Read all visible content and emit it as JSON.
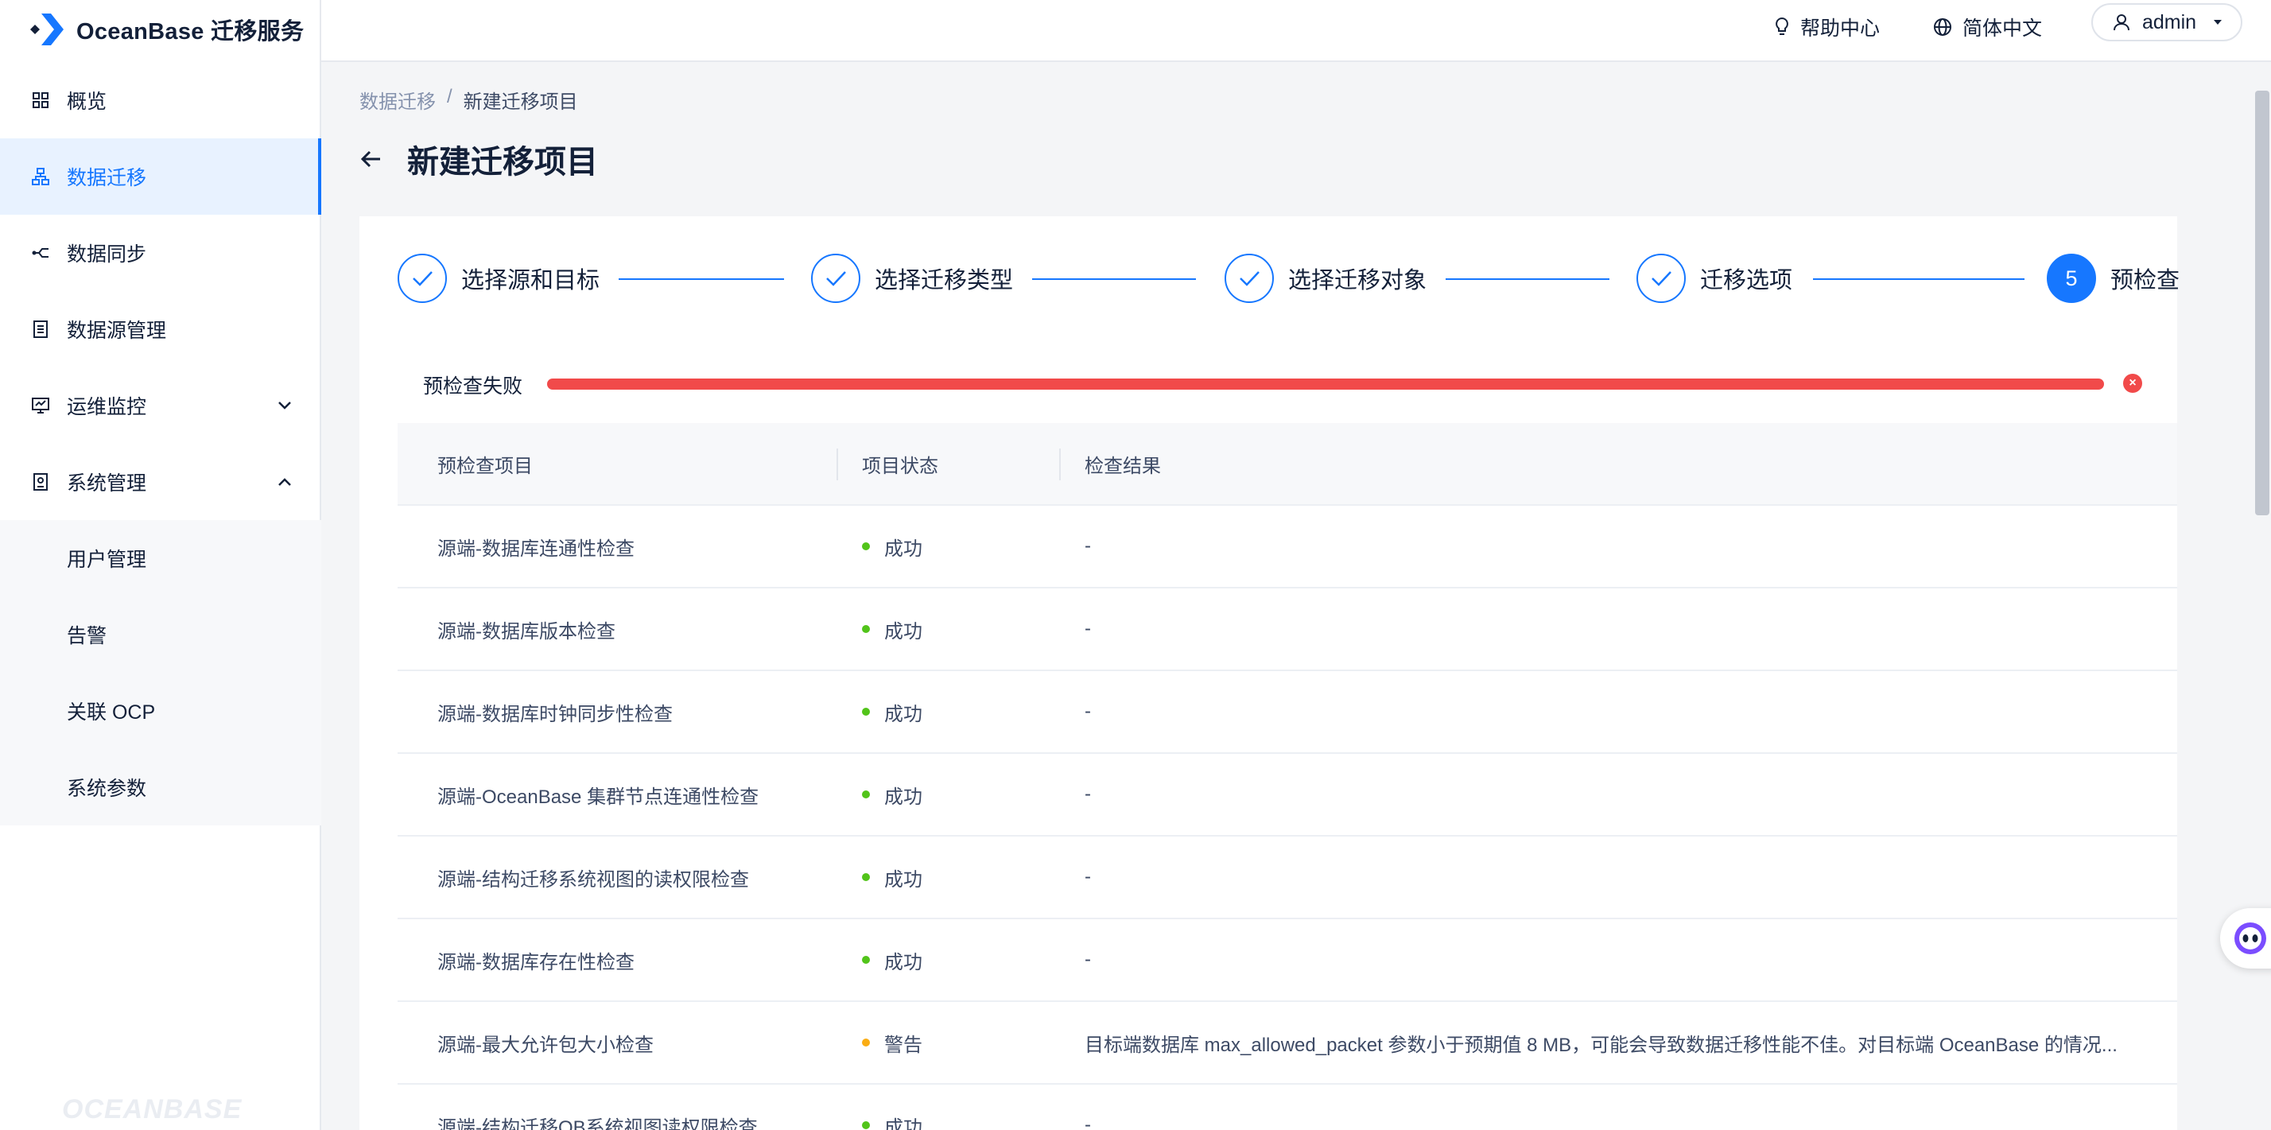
{
  "app": {
    "name": "OceanBase 迁移服务",
    "watermark": "OCEANBASE",
    "colors": {
      "accent": "#1677ff",
      "error": "#f14a4a",
      "success": "#52c41a",
      "warning": "#faad14"
    }
  },
  "sidebar": {
    "items": [
      {
        "label": "概览",
        "icon": "dashboard-grid-icon"
      },
      {
        "label": "数据迁移",
        "icon": "migration-tree-icon",
        "active": true
      },
      {
        "label": "数据同步",
        "icon": "sync-branch-icon"
      },
      {
        "label": "数据源管理",
        "icon": "datasource-doc-icon"
      },
      {
        "label": "运维监控",
        "icon": "monitor-icon",
        "expandable": true,
        "expanded": false
      },
      {
        "label": "系统管理",
        "icon": "system-panel-icon",
        "expandable": true,
        "expanded": true
      }
    ],
    "submenu": [
      {
        "label": "用户管理"
      },
      {
        "label": "告警"
      },
      {
        "label": "关联 OCP"
      },
      {
        "label": "系统参数"
      }
    ]
  },
  "topbar": {
    "help_label": "帮助中心",
    "language_label": "简体中文",
    "user_label": "admin"
  },
  "breadcrumb": {
    "parent": "数据迁移",
    "separator": "/",
    "current": "新建迁移项目"
  },
  "page": {
    "title": "新建迁移项目"
  },
  "steps": [
    {
      "label": "选择源和目标",
      "status": "done"
    },
    {
      "label": "选择迁移类型",
      "status": "done"
    },
    {
      "label": "选择迁移对象",
      "status": "done"
    },
    {
      "label": "迁移选项",
      "status": "done"
    },
    {
      "label": "预检查",
      "number": "5",
      "status": "current"
    }
  ],
  "precheck": {
    "status_label": "预检查失败",
    "progress": 1.0
  },
  "table": {
    "headers": [
      "预检查项目",
      "项目状态",
      "检查结果"
    ],
    "rows": [
      {
        "item": "源端-数据库连通性检查",
        "status": "成功",
        "status_type": "success",
        "result": "-"
      },
      {
        "item": "源端-数据库版本检查",
        "status": "成功",
        "status_type": "success",
        "result": "-"
      },
      {
        "item": "源端-数据库时钟同步性检查",
        "status": "成功",
        "status_type": "success",
        "result": "-"
      },
      {
        "item": "源端-OceanBase 集群节点连通性检查",
        "status": "成功",
        "status_type": "success",
        "result": "-"
      },
      {
        "item": "源端-结构迁移系统视图的读权限检查",
        "status": "成功",
        "status_type": "success",
        "result": "-"
      },
      {
        "item": "源端-数据库存在性检查",
        "status": "成功",
        "status_type": "success",
        "result": "-"
      },
      {
        "item": "源端-最大允许包大小检查",
        "status": "警告",
        "status_type": "warning",
        "result": "目标端数据库 max_allowed_packet 参数小于预期值 8 MB，可能会导致数据迁移性能不佳。对目标端 OceanBase 的情况..."
      },
      {
        "item": "源端-结构迁移OB系统视图读权限检查",
        "status": "成功",
        "status_type": "success",
        "result": "-"
      }
    ]
  }
}
